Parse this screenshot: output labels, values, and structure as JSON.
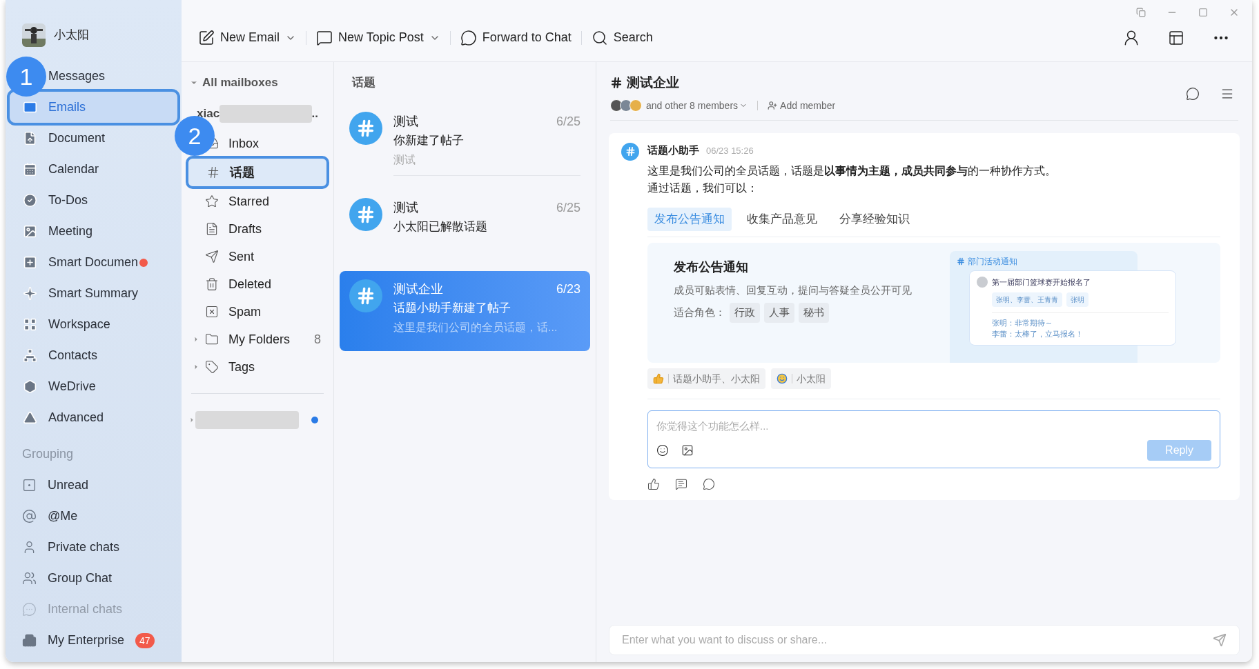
{
  "user": {
    "name": "小太阳"
  },
  "nav": [
    {
      "label": "Messages",
      "selected": false,
      "dot": false
    },
    {
      "label": "Emails",
      "selected": true,
      "dot": false
    },
    {
      "label": "Document",
      "selected": false,
      "dot": false
    },
    {
      "label": "Calendar",
      "selected": false,
      "dot": false
    },
    {
      "label": "To-Dos",
      "selected": false,
      "dot": false
    },
    {
      "label": "Meeting",
      "selected": false,
      "dot": false
    },
    {
      "label": "Smart Documen",
      "selected": false,
      "dot": true
    },
    {
      "label": "Smart Summary",
      "selected": false,
      "dot": false
    },
    {
      "label": "Workspace",
      "selected": false,
      "dot": false
    },
    {
      "label": "Contacts",
      "selected": false,
      "dot": false
    },
    {
      "label": "WeDrive",
      "selected": false,
      "dot": false
    },
    {
      "label": "Advanced",
      "selected": false,
      "dot": false
    }
  ],
  "grouping": {
    "heading": "Grouping",
    "items": [
      {
        "label": "Unread",
        "faded": false
      },
      {
        "label": "@Me",
        "faded": false
      },
      {
        "label": "Private chats",
        "faded": false
      },
      {
        "label": "Group Chat",
        "faded": false
      },
      {
        "label": "Internal chats",
        "faded": true
      }
    ]
  },
  "enterprise": {
    "label": "My Enterprise",
    "badge": "47"
  },
  "toolbar": [
    {
      "label": "New Email",
      "dropdown": true
    },
    {
      "label": "New Topic Post",
      "dropdown": true
    },
    {
      "label": "Forward to Chat",
      "dropdown": false
    },
    {
      "label": "Search",
      "dropdown": false
    }
  ],
  "mailboxes": {
    "heading": "All mailboxes",
    "account": "xiac",
    "account_more": "..",
    "folders": [
      {
        "label": "Inbox",
        "selected": false
      },
      {
        "label": "话题",
        "selected": true
      },
      {
        "label": "Starred",
        "selected": false
      },
      {
        "label": "Drafts",
        "selected": false
      },
      {
        "label": "Sent",
        "selected": false
      },
      {
        "label": "Deleted",
        "selected": false
      },
      {
        "label": "Spam",
        "selected": false
      },
      {
        "label": "My Folders",
        "selected": false,
        "expandable": true,
        "count": "8"
      },
      {
        "label": "Tags",
        "selected": false,
        "expandable": true
      }
    ],
    "second_account_unread": true
  },
  "topics": {
    "heading": "话题",
    "items": [
      {
        "title": "测试",
        "date": "6/25",
        "subtitle": "你新建了帖子",
        "preview": "测试",
        "selected": false
      },
      {
        "title": "测试",
        "date": "6/25",
        "subtitle": "小太阳已解散话题",
        "selected": false
      },
      {
        "title": "测试企业",
        "date": "6/23",
        "subtitle": "话题小助手新建了帖子",
        "preview": "这里是我们公司的全员话题，话...",
        "selected": true
      }
    ]
  },
  "chat": {
    "title": "测试企业",
    "members": "and other 8 members",
    "add_member": "Add member",
    "message": {
      "author": "话题小助手",
      "time": "06/23 15:26",
      "line1": "这里是我们公司的全员话题，话题是**以事情为主题，成员共同参与**的一种协作方式。",
      "line2": "通过话题，我们可以：",
      "tabs": [
        {
          "label": "发布公告通知",
          "selected": true
        },
        {
          "label": "收集产品意见",
          "selected": false
        },
        {
          "label": "分享经验知识",
          "selected": false
        }
      ],
      "card": {
        "title": "发布公告通知",
        "description": "成员可贴表情、回复互动，提问与答疑全员公开可见",
        "roles_label": "适合角色：",
        "roles": [
          "行政",
          "人事",
          "秘书"
        ],
        "preview": {
          "heading": "部门活动通知",
          "post": "第一届部门篮球赛开始报名了",
          "reactions": [
            "张明、李蕾、王青青",
            "张明"
          ],
          "comments": [
            "张明：非常期待～",
            "李蕾：太棒了，立马报名！"
          ]
        }
      },
      "reactions": [
        "话题小助手、小太阳",
        "小太阳"
      ],
      "reply": {
        "placeholder": "你觉得这个功能怎么样...",
        "button": "Reply"
      }
    },
    "composer": {
      "placeholder": "Enter what you want to discuss or share..."
    }
  },
  "callouts": [
    "1",
    "2"
  ]
}
